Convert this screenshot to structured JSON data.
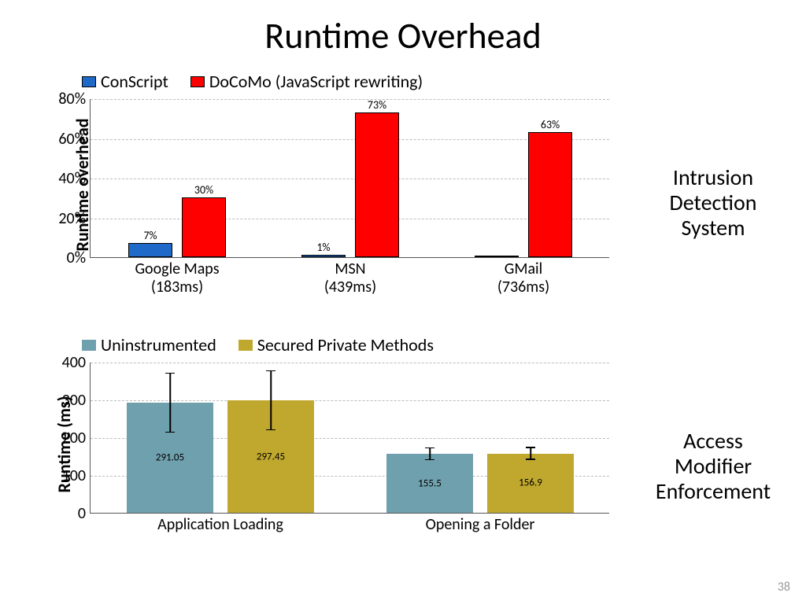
{
  "title": "Runtime Overhead",
  "page_number": "38",
  "side_labels": {
    "ids": "Intrusion\nDetection\nSystem",
    "ame": "Access\nModifier\nEnforcement"
  },
  "chart_data": [
    {
      "type": "bar",
      "title": "",
      "ylabel": "Runtime overhead",
      "xlabel": "",
      "ylim": [
        0,
        80
      ],
      "y_ticks": [
        "0%",
        "20%",
        "40%",
        "60%",
        "80%"
      ],
      "categories": [
        "Google Maps (183ms)",
        "MSN (439ms)",
        "GMail (736ms)"
      ],
      "series": [
        {
          "name": "ConScript",
          "color": "#1f69c8",
          "values": [
            7,
            1,
            0
          ],
          "labels": [
            "7%",
            "1%",
            ""
          ]
        },
        {
          "name": "DoCoMo (JavaScript rewriting)",
          "color": "#ff0000",
          "values": [
            30,
            73,
            63
          ],
          "labels": [
            "30%",
            "73%",
            "63%"
          ]
        }
      ]
    },
    {
      "type": "bar",
      "title": "",
      "ylabel": "Runtime (ms)",
      "xlabel": "",
      "ylim": [
        0,
        400
      ],
      "y_ticks": [
        "0",
        "100",
        "200",
        "300",
        "400"
      ],
      "categories": [
        "Application Loading",
        "Opening a Folder"
      ],
      "series": [
        {
          "name": "Uninstrumented",
          "color": "#6fa0ad",
          "values": [
            291.05,
            155.5
          ],
          "labels": [
            "291.05",
            "155.5"
          ]
        },
        {
          "name": "Secured Private Methods",
          "color": "#c0a82e",
          "values": [
            297.45,
            156.9
          ],
          "labels": [
            "297.45",
            "156.9"
          ]
        }
      ],
      "error_bars": true
    }
  ]
}
